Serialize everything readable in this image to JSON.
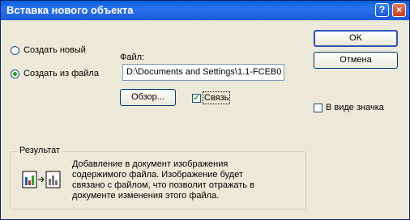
{
  "window": {
    "title": "Вставка нового объекта",
    "help_glyph": "?",
    "close_glyph": "×"
  },
  "options": {
    "create_new": "Создать новый",
    "create_from_file": "Создать из файла"
  },
  "file": {
    "label": "Файл:",
    "value": "D:\\Documents and Settings\\1.1-FCEB0"
  },
  "buttons": {
    "ok": "OK",
    "cancel": "Отмена",
    "browse": "Обзор..."
  },
  "checkboxes": {
    "link": "Связь",
    "link_checked": true,
    "as_icon": "В виде значка",
    "as_icon_checked": false
  },
  "result": {
    "label": "Результат",
    "text": "Добавление в документ изображения содержимого файла.  Изображение будет связано с файлом, что позволит отражать в документе изменения этого файла."
  },
  "colors": {
    "titlebar": "#0a5fd8",
    "dialog_bg": "#ece9d8",
    "accent": "#21a121"
  }
}
